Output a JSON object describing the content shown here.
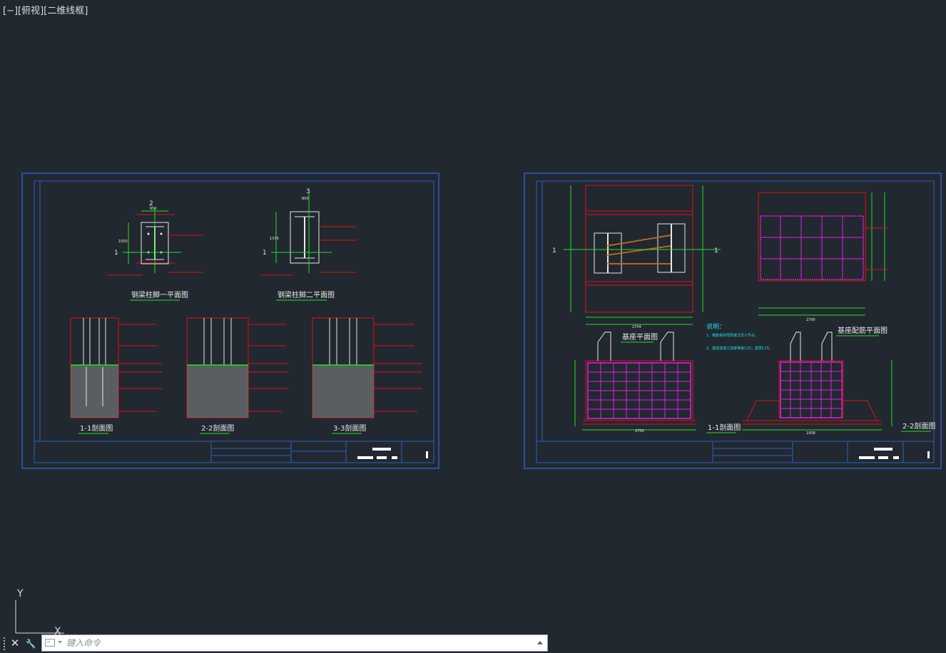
{
  "viewport": {
    "label": "[−][俯视][二维线框]"
  },
  "colors": {
    "background": "#212830",
    "frame_blue": "#2a5fbf",
    "line_white": "#e8e8e8",
    "line_red": "#e01010",
    "line_green": "#22e022",
    "line_magenta": "#e020e0",
    "line_cyan": "#20e0e0",
    "hatch_gray": "#9a9a9a",
    "title_box_white": "#ffffff"
  },
  "sheet_left": {
    "labels": {
      "plan1_title": "钢梁柱脚一平面图",
      "plan2_title": "钢梁柱脚二平面图",
      "sec1_title": "1-1剖面图",
      "sec2_title": "2-2剖面图",
      "sec3_title": "3-3剖面图",
      "mark1": "1",
      "mark2": "2",
      "mark3": "3",
      "dim_a": "650",
      "dim_b": "850",
      "dim_c": "1050",
      "dim_d": "1370"
    }
  },
  "sheet_right": {
    "labels": {
      "plan_title": "基座平面图",
      "rebar_title": "基座配筋平面图",
      "sec1_title": "1-1剖面图",
      "sec2_title": "2-2剖面图",
      "notes_title": "说明：",
      "note1": "1、钢筋保护层厚度详见①节点。",
      "note2": "2、基础混凝土强度等级C25，垫层C15。",
      "mark1": "1",
      "dim_w1": "2700",
      "dim_w2": "2704",
      "dim_h": "1958",
      "dim_rebar": "2700"
    }
  },
  "ucs": {
    "y_label": "Y",
    "x_label": "X"
  },
  "command_line": {
    "placeholder": "键入命令",
    "close_glyph": "✕",
    "customize_glyph": "🔧"
  }
}
